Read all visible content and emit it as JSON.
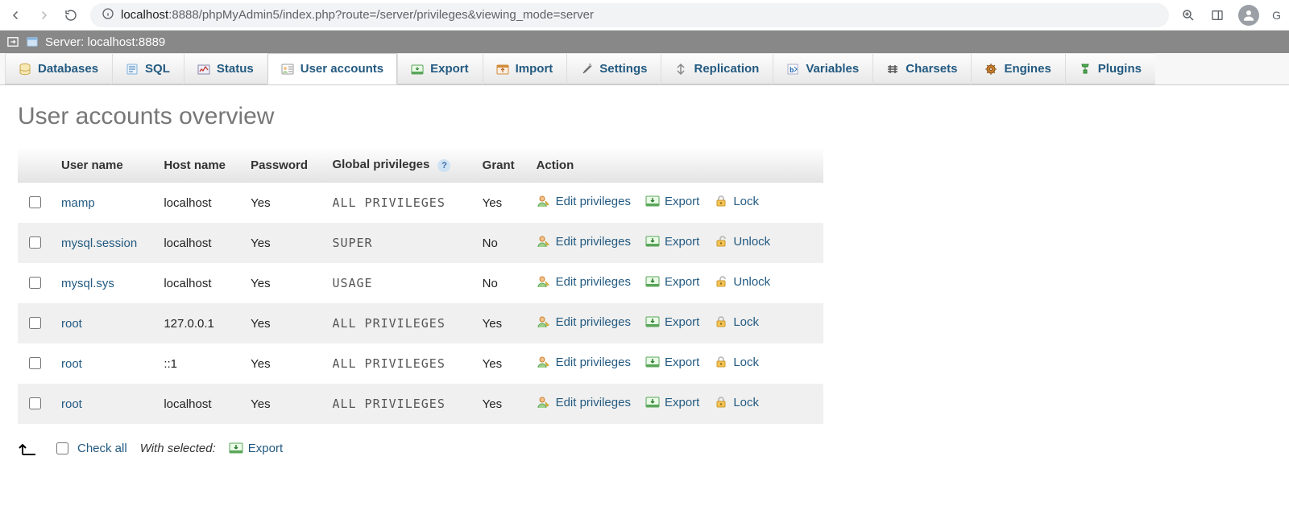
{
  "browser": {
    "url_host_prefix": "localhost",
    "url_port_path": ":8888/phpMyAdmin5/index.php?route=/server/privileges&viewing_mode=server",
    "profile_initial": "G"
  },
  "serverbar": {
    "label": "Server: localhost:8889"
  },
  "tabs": [
    {
      "label": "Databases",
      "icon": "database-icon"
    },
    {
      "label": "SQL",
      "icon": "sql-icon"
    },
    {
      "label": "Status",
      "icon": "status-icon"
    },
    {
      "label": "User accounts",
      "icon": "user-accounts-icon",
      "active": true
    },
    {
      "label": "Export",
      "icon": "export-icon"
    },
    {
      "label": "Import",
      "icon": "import-icon"
    },
    {
      "label": "Settings",
      "icon": "settings-icon"
    },
    {
      "label": "Replication",
      "icon": "replication-icon"
    },
    {
      "label": "Variables",
      "icon": "variables-icon"
    },
    {
      "label": "Charsets",
      "icon": "charsets-icon"
    },
    {
      "label": "Engines",
      "icon": "engines-icon"
    },
    {
      "label": "Plugins",
      "icon": "plugins-icon"
    }
  ],
  "page": {
    "title": "User accounts overview"
  },
  "table": {
    "headers": {
      "checkbox": "",
      "username": "User name",
      "hostname": "Host name",
      "password": "Password",
      "global": "Global privileges",
      "grant": "Grant",
      "action": "Action"
    },
    "action_labels": {
      "edit": "Edit privileges",
      "export": "Export",
      "lock": "Lock",
      "unlock": "Unlock"
    },
    "rows": [
      {
        "user": "mamp",
        "host": "localhost",
        "password": "Yes",
        "priv": "ALL PRIVILEGES",
        "grant": "Yes",
        "lock": "Lock"
      },
      {
        "user": "mysql.session",
        "host": "localhost",
        "password": "Yes",
        "priv": "SUPER",
        "grant": "No",
        "lock": "Unlock"
      },
      {
        "user": "mysql.sys",
        "host": "localhost",
        "password": "Yes",
        "priv": "USAGE",
        "grant": "No",
        "lock": "Unlock"
      },
      {
        "user": "root",
        "host": "127.0.0.1",
        "password": "Yes",
        "priv": "ALL PRIVILEGES",
        "grant": "Yes",
        "lock": "Lock"
      },
      {
        "user": "root",
        "host": "::1",
        "password": "Yes",
        "priv": "ALL PRIVILEGES",
        "grant": "Yes",
        "lock": "Lock"
      },
      {
        "user": "root",
        "host": "localhost",
        "password": "Yes",
        "priv": "ALL PRIVILEGES",
        "grant": "Yes",
        "lock": "Lock"
      }
    ]
  },
  "footer": {
    "check_all": "Check all",
    "with_selected": "With selected:",
    "export": "Export"
  }
}
